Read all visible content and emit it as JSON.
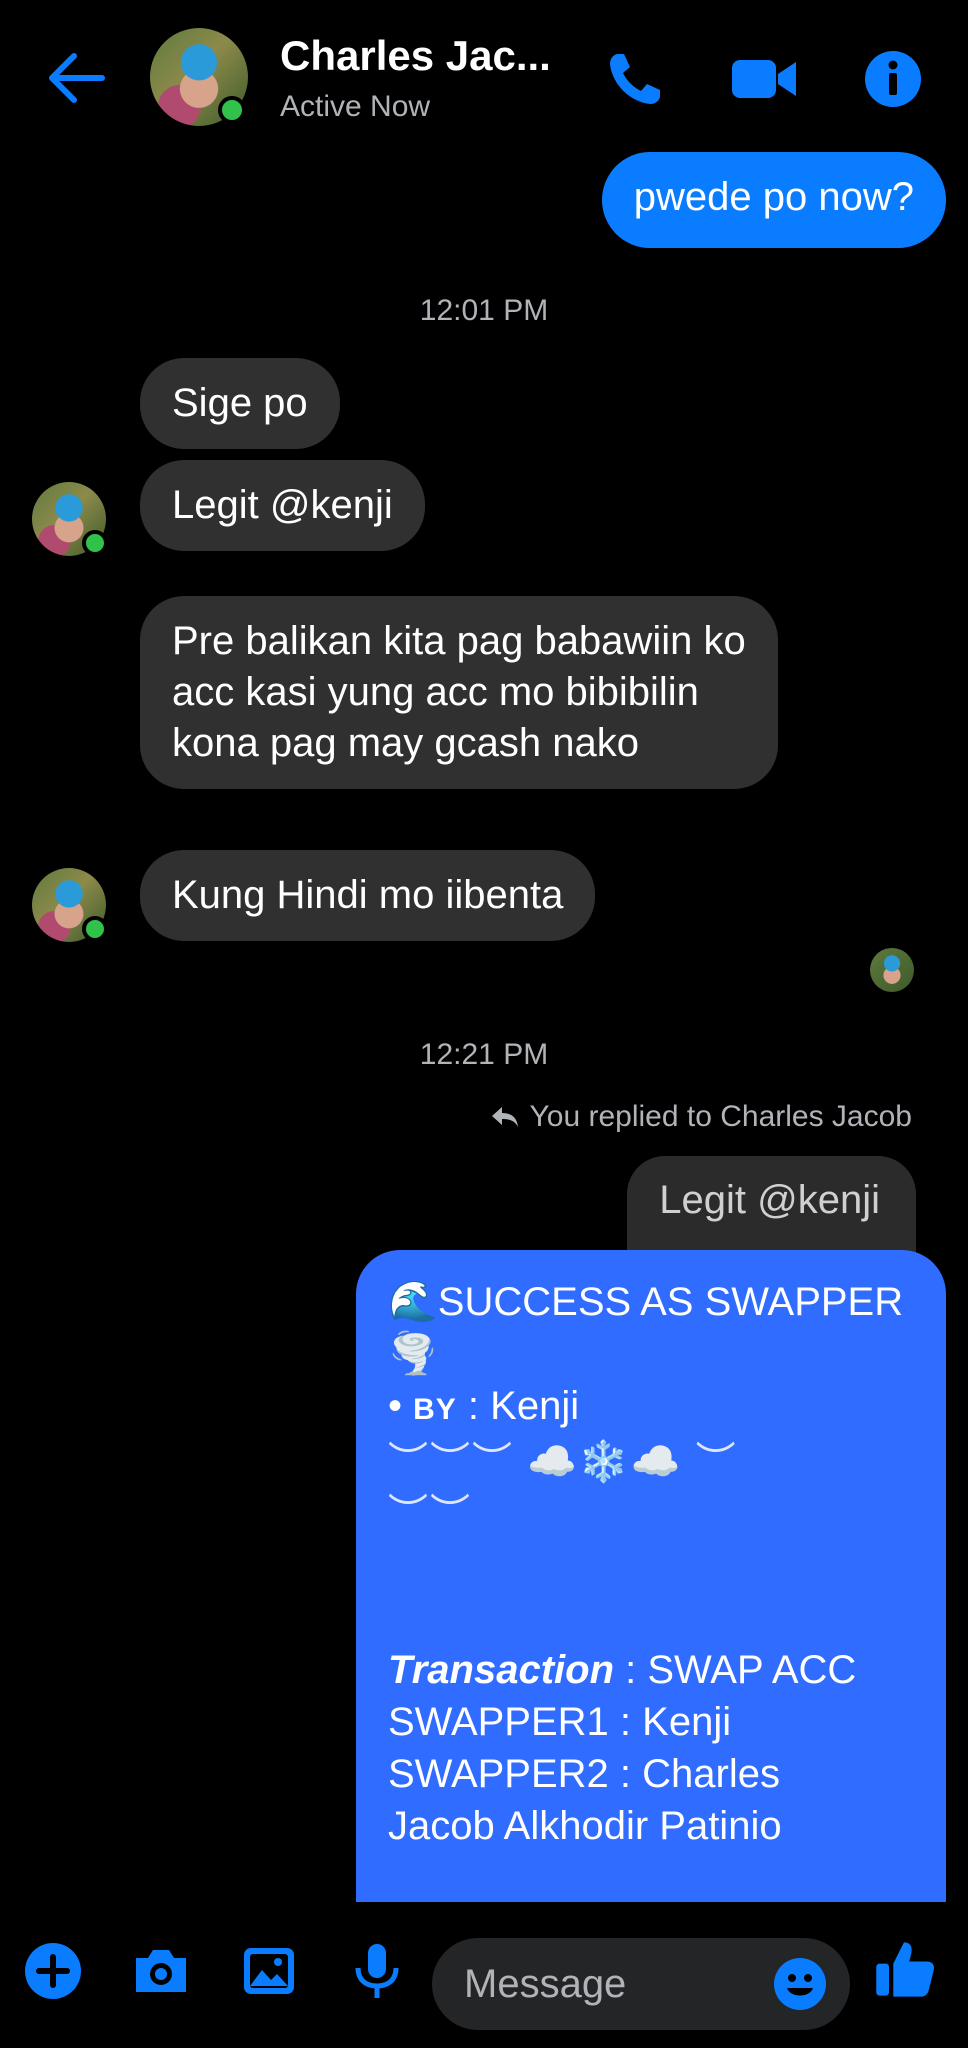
{
  "header": {
    "contact_name": "Charles Jac...",
    "status": "Active Now",
    "icons": [
      "back-arrow-icon",
      "phone-icon",
      "video-icon",
      "info-icon"
    ]
  },
  "colors": {
    "accent": "#0a7cff",
    "highlight_bubble": "#2f6cff",
    "incoming_bubble": "#303030",
    "online": "#31c24a",
    "muted_text": "#b0b3b8"
  },
  "messages": {
    "m1": "pwede po now?",
    "ts1": "12:01 PM",
    "m2": "Sige po",
    "m3": "Legit @kenji",
    "m4": "Pre balikan kita pag babawiin ko acc kasi yung acc mo bibibilin kona pag may gcash nako",
    "m5": "Kung Hindi mo iibenta",
    "ts2": "12:21 PM",
    "replied_label": "You replied to Charles Jacob",
    "quoted": "Legit @kenji"
  },
  "card": {
    "title": "🌊SUCCESS AS SWAPPER",
    "title_emoji": "🌪️",
    "by_prefix": "• ",
    "by_label": "BY",
    "by_value": " : Kenji",
    "deco1": "︶︶︶ ☁️❄️☁️ ︶",
    "deco2": "︶︶",
    "transaction_label": "Transaction",
    "transaction_value": " : SWAP ACC",
    "swapper1": "SWAPPER1 : Kenji",
    "swapper2_a": "SWAPPER2 : Charles",
    "swapper2_b": "Jacob Alkhodir Patinio",
    "footer_deco": "☁️ 🌪️"
  },
  "composer": {
    "placeholder": "Message",
    "icons": [
      "plus-icon",
      "camera-icon",
      "image-icon",
      "microphone-icon",
      "emoji-icon",
      "thumbs-up-icon"
    ]
  }
}
